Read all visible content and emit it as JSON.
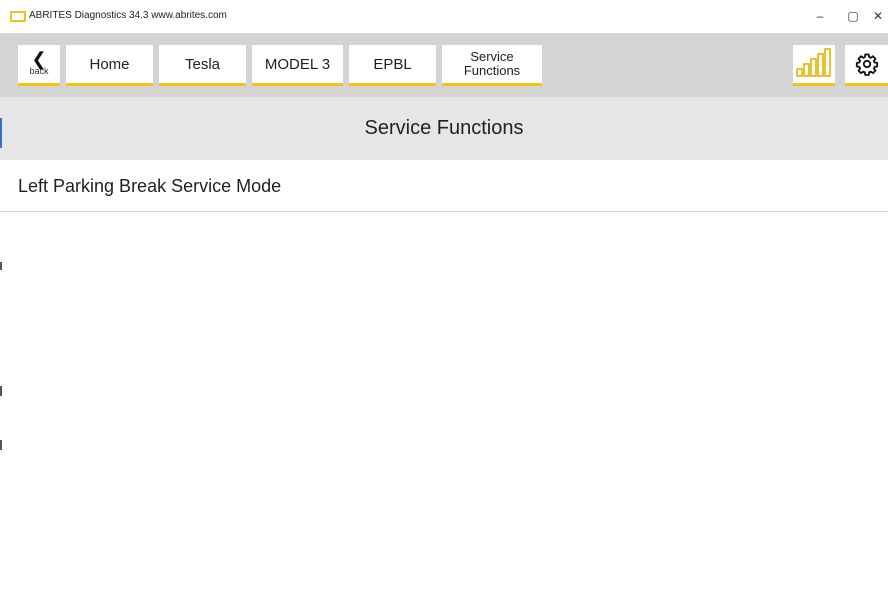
{
  "window": {
    "title": "ABRITES Diagnostics 34.3   www.abrites.com",
    "minimize": "–",
    "maximize": "▢",
    "close": "✕"
  },
  "nav": {
    "back_label": "back",
    "back_glyph": "❮",
    "items": [
      {
        "label": "Home"
      },
      {
        "label": "Tesla"
      },
      {
        "label": "MODEL 3"
      },
      {
        "label": "EPBL"
      },
      {
        "label": "Service Functions"
      }
    ],
    "icons": {
      "signal": "signal-strength-icon",
      "settings": "gear-icon"
    }
  },
  "section": {
    "title": "Service Functions"
  },
  "list": {
    "items": [
      {
        "label": "Left Parking Break Service Mode"
      }
    ]
  },
  "colors": {
    "accent": "#f4c21a",
    "navbar_bg": "#d4d4d4",
    "header_bg": "#e6e6e6"
  }
}
